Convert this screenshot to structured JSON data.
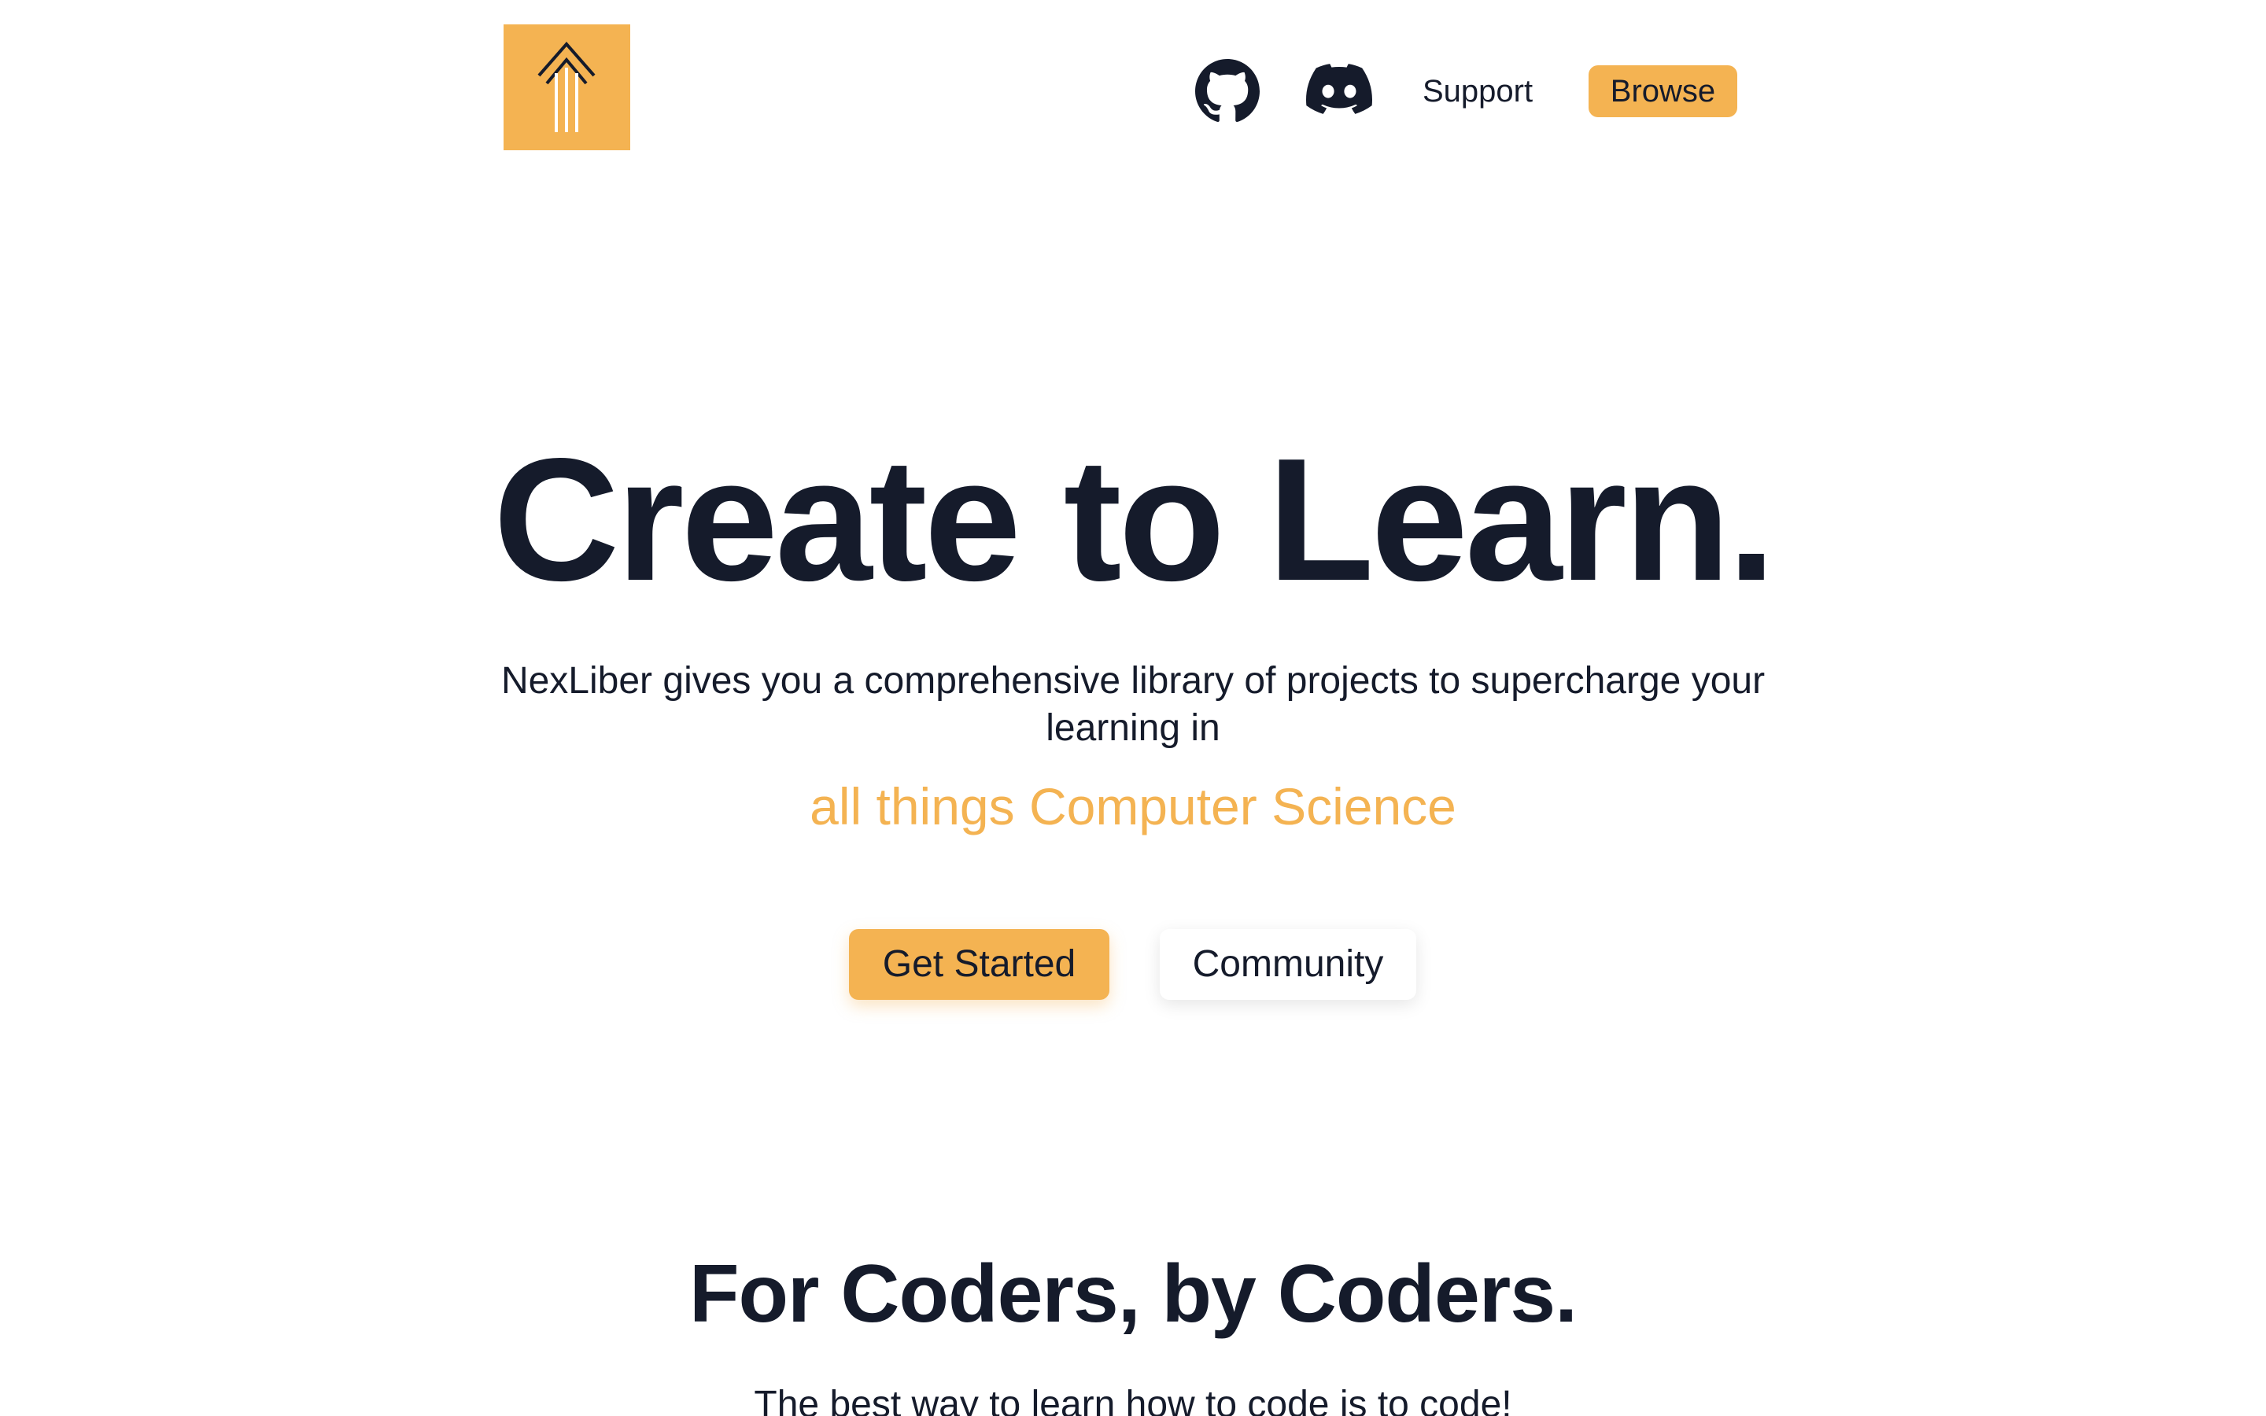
{
  "header": {
    "logo_icon": "upward-arrow-lines-icon",
    "github_icon": "github-icon",
    "discord_icon": "discord-icon",
    "support_label": "Support",
    "browse_label": "Browse"
  },
  "hero": {
    "title": "Create to Learn.",
    "subtitle": "NexLiber gives you a comprehensive library of projects to supercharge your learning in",
    "accent": "all things Computer Science",
    "get_started_label": "Get Started",
    "community_label": "Community"
  },
  "section": {
    "title": "For Coders, by Coders.",
    "subtitle": "The best way to learn how to code is to code!"
  },
  "colors": {
    "accent": "#f4b352",
    "text": "#151b2b",
    "background": "#ffffff"
  }
}
